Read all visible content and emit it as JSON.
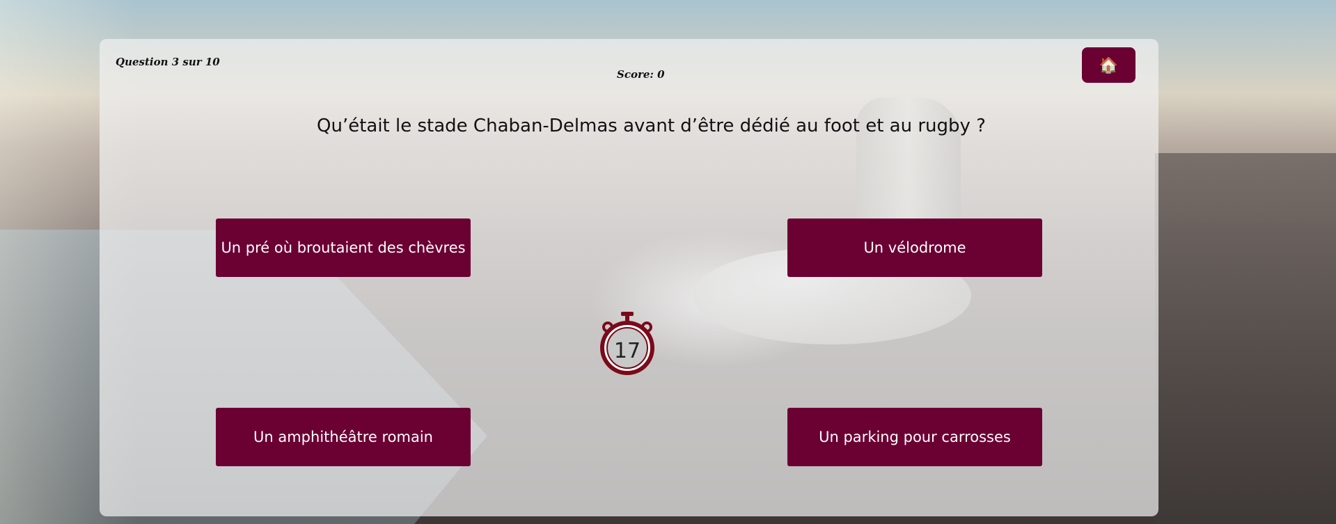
{
  "quiz": {
    "progress_label": "Question 3 sur 10",
    "score_label": "Score: 0",
    "home_icon": "🏠",
    "question": "Qu’était le stade Chaban-Delmas avant d’être dédié au foot et au rugby ?",
    "answers": [
      "Un pré où broutaient des chèvres",
      "Un vélodrome",
      "Un amphithéâtre romain",
      "Un parking pour carrosses"
    ],
    "timer_value": "17"
  },
  "colors": {
    "accent": "#6b0033",
    "timer_ring": "#7a0a1a"
  }
}
